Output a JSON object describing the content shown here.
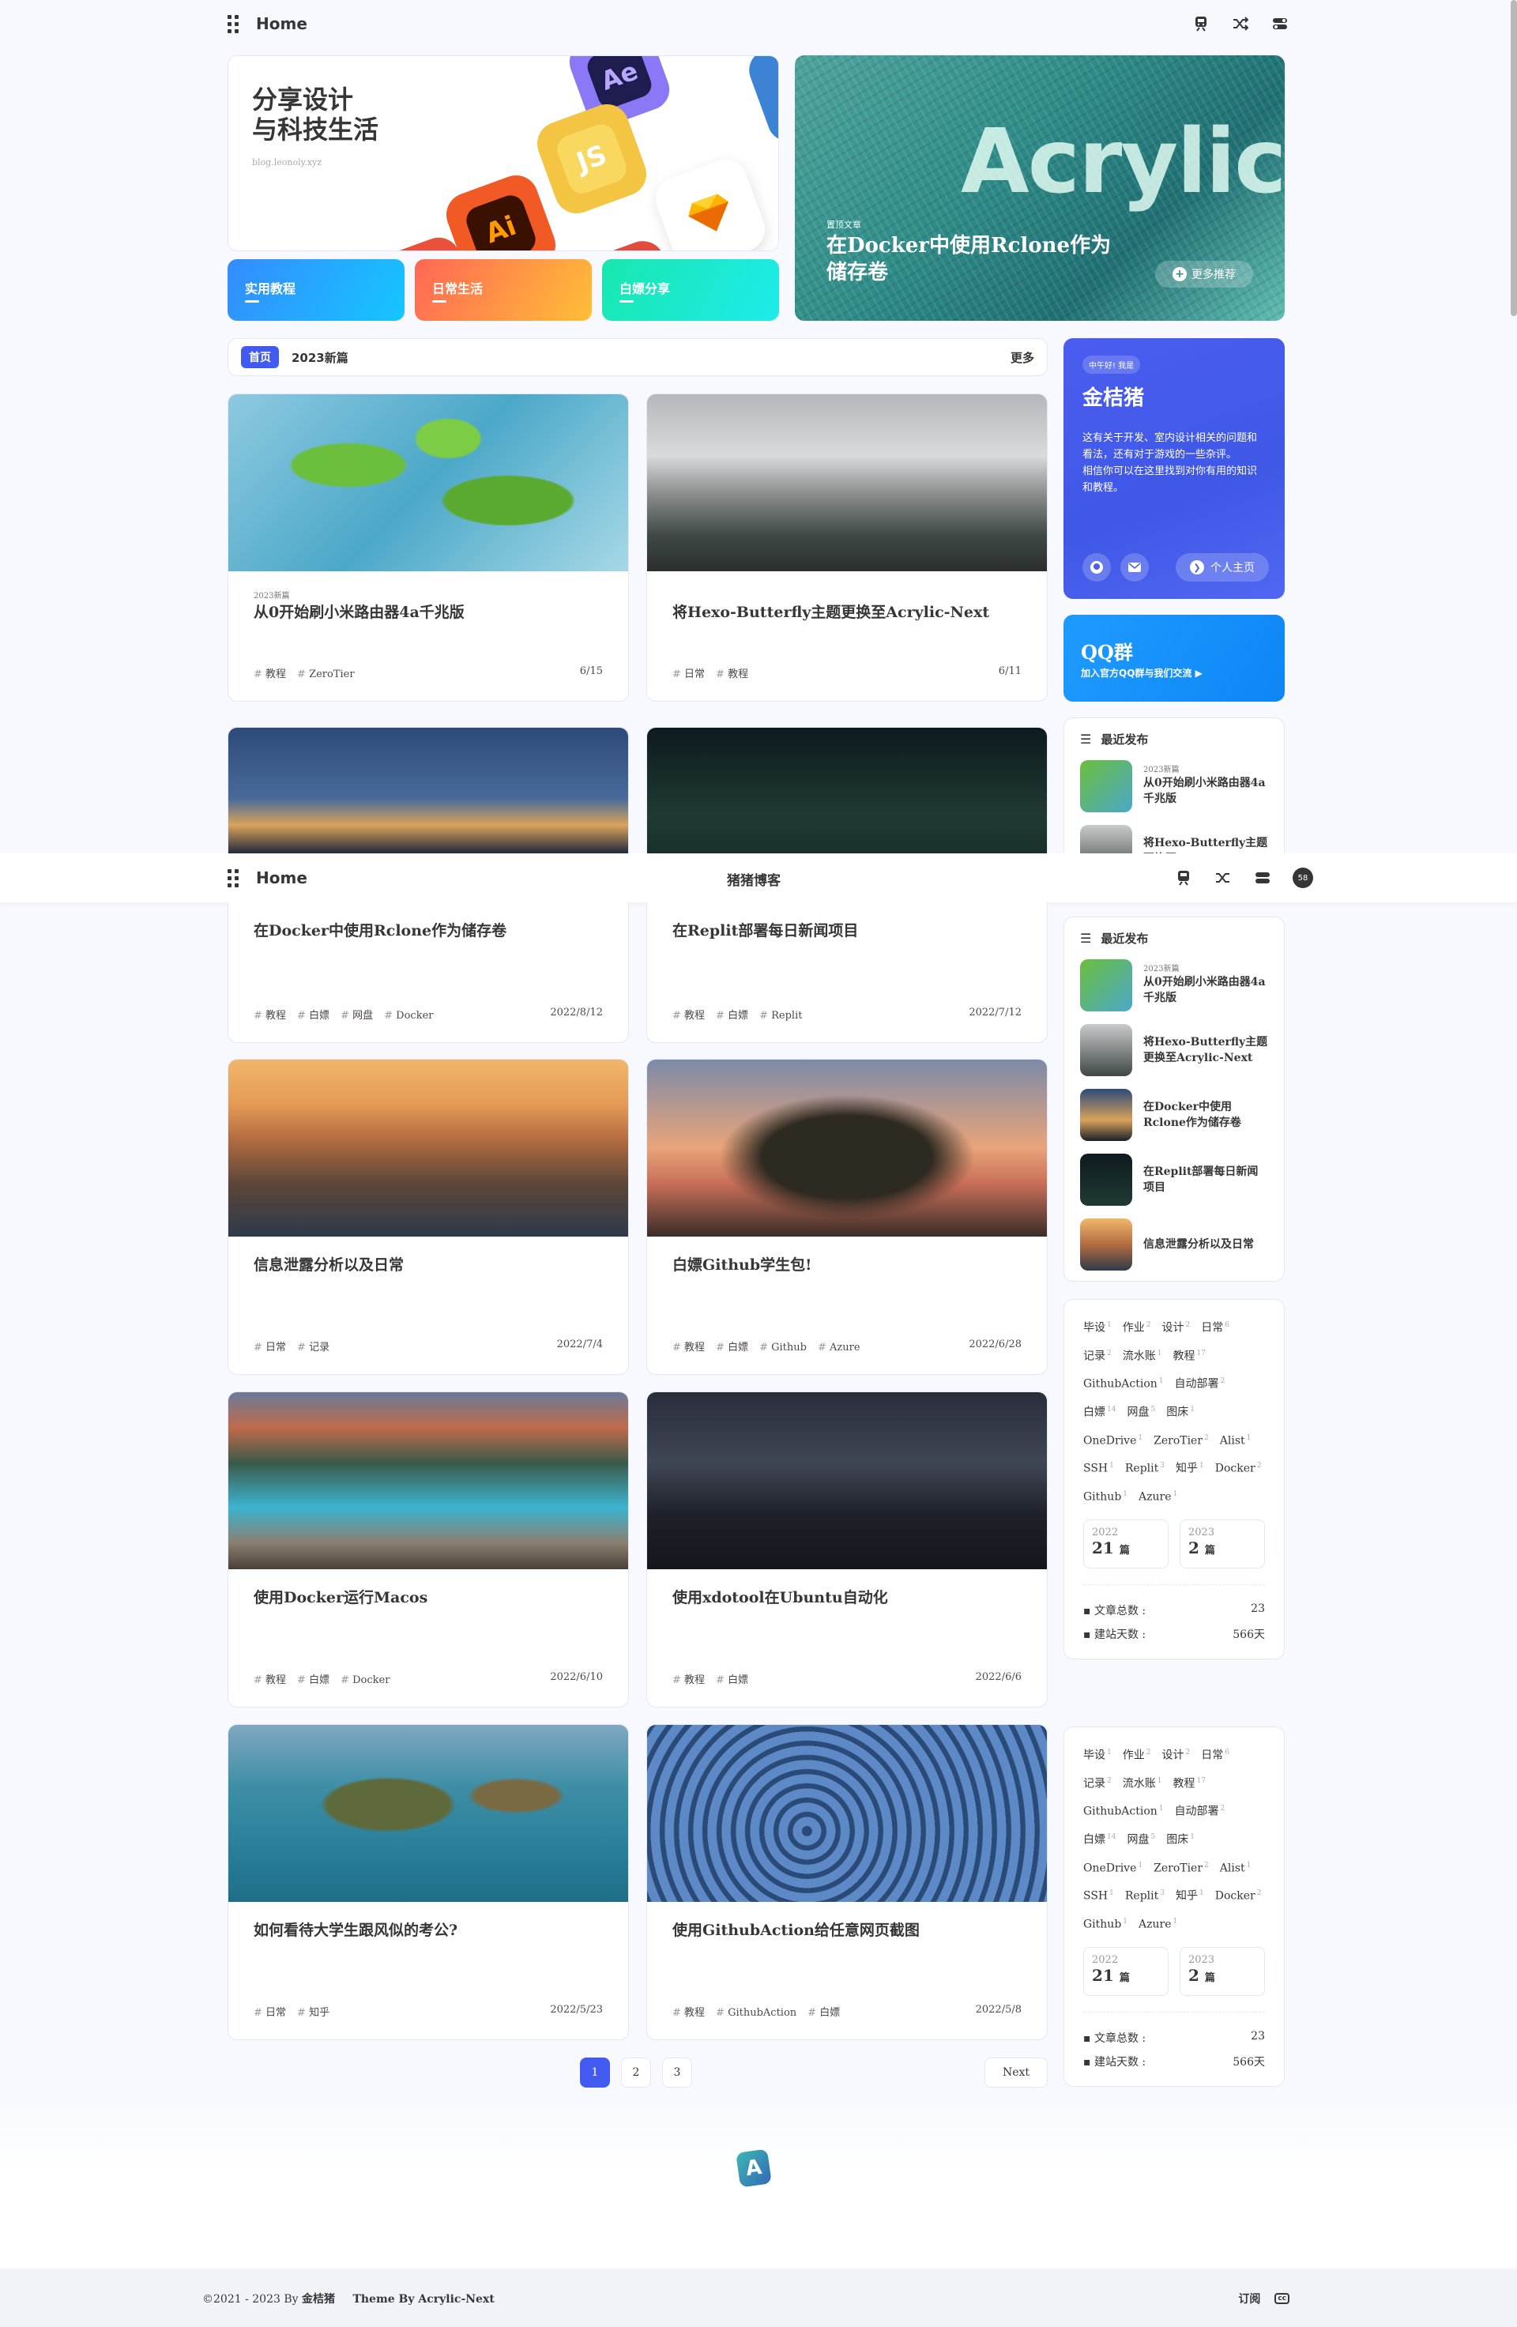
{
  "top_nav": {
    "brand": "Home"
  },
  "sticky_nav": {
    "brand": "Home",
    "center_title": "猪猪博客",
    "avatar": "58"
  },
  "hero": {
    "slogan_line1": "分享设计",
    "slogan_line2": "与科技生活",
    "site_url": "blog.leonoly.xyz",
    "icon_tiles": [
      "Ai",
      "JS",
      "Ae"
    ],
    "categories": [
      {
        "label": "实用教程",
        "color": "#358bff"
      },
      {
        "label": "日常生活",
        "color": "#f65"
      },
      {
        "label": "白嫖分享",
        "color": "#18e7ae"
      }
    ],
    "featured_tag": "置顶文章",
    "featured_title": "在Docker中使用Rclone作为储存卷",
    "featured_bg_text": "Acrylic",
    "more_label": "更多推荐"
  },
  "category_bar": {
    "home_label": "首页",
    "active": "2023新篇",
    "more": "更多"
  },
  "posts": [
    {
      "badge": "2023新篇",
      "title": "从0开始刷小米路由器4a千兆版",
      "tags": [
        "教程",
        "ZeroTier"
      ],
      "date": "6/15"
    },
    {
      "badge": "",
      "title": "将Hexo-Butterfly主题更换至Acrylic-Next",
      "tags": [
        "日常",
        "教程"
      ],
      "date": "6/11"
    },
    {
      "badge": "",
      "title": "在Docker中使用Rclone作为储存卷",
      "tags": [
        "教程",
        "白嫖",
        "网盘",
        "Docker"
      ],
      "date": "2022/8/12"
    },
    {
      "badge": "",
      "title": "在Replit部署每日新闻项目",
      "tags": [
        "教程",
        "白嫖",
        "Replit"
      ],
      "date": "2022/7/12"
    },
    {
      "badge": "",
      "title": "信息泄露分析以及日常",
      "tags": [
        "日常",
        "记录"
      ],
      "date": "2022/7/4"
    },
    {
      "badge": "",
      "title": "白嫖Github学生包!",
      "tags": [
        "教程",
        "白嫖",
        "Github",
        "Azure"
      ],
      "date": "2022/6/28"
    },
    {
      "badge": "",
      "title": "使用Docker运行Macos",
      "tags": [
        "教程",
        "白嫖",
        "Docker"
      ],
      "date": "2022/6/10"
    },
    {
      "badge": "",
      "title": "使用xdotool在Ubuntu自动化",
      "tags": [
        "教程",
        "白嫖"
      ],
      "date": "2022/6/6"
    },
    {
      "badge": "",
      "title": "如何看待大学生跟风似的考公?",
      "tags": [
        "日常",
        "知乎"
      ],
      "date": "2022/5/23"
    },
    {
      "badge": "",
      "title": "使用GithubAction给任意网页截图",
      "tags": [
        "教程",
        "GithubAction",
        "白嫖"
      ],
      "date": "2022/5/8"
    }
  ],
  "profile": {
    "greeting": "中午好! 我是",
    "name": "金桔猪",
    "desc1": "这有关于开发、室内设计相关的问题和看法，还有对于游戏的一些杂评。",
    "desc2": "相信你可以在这里找到对你有用的知识和教程。",
    "home_button": "个人主页"
  },
  "qq": {
    "title": "QQ群",
    "subtitle": "加入官方QQ群与我们交流 ▶"
  },
  "recent": {
    "title": "最近发布",
    "items": [
      {
        "badge": "2023新篇",
        "title": "从0开始刷小米路由器4a千兆版"
      },
      {
        "badge": "",
        "title": "将Hexo-Butterfly主题更换至Acrylic-Next"
      },
      {
        "badge": "",
        "title": "在Docker中使用Rclone作为储存卷"
      },
      {
        "badge": "",
        "title": "在Replit部署每日新闻项目"
      },
      {
        "badge": "",
        "title": "信息泄露分析以及日常"
      }
    ]
  },
  "tags": [
    {
      "n": "毕设",
      "c": "1"
    },
    {
      "n": "作业",
      "c": "2"
    },
    {
      "n": "设计",
      "c": "2"
    },
    {
      "n": "日常",
      "c": "6"
    },
    {
      "n": "记录",
      "c": "2"
    },
    {
      "n": "流水账",
      "c": "1"
    },
    {
      "n": "教程",
      "c": "17"
    },
    {
      "n": "GithubAction",
      "c": "1"
    },
    {
      "n": "自动部署",
      "c": "2"
    },
    {
      "n": "白嫖",
      "c": "14"
    },
    {
      "n": "网盘",
      "c": "5"
    },
    {
      "n": "图床",
      "c": "1"
    },
    {
      "n": "OneDrive",
      "c": "1"
    },
    {
      "n": "ZeroTier",
      "c": "2"
    },
    {
      "n": "Alist",
      "c": "1"
    },
    {
      "n": "SSH",
      "c": "1"
    },
    {
      "n": "Replit",
      "c": "3"
    },
    {
      "n": "知乎",
      "c": "1"
    },
    {
      "n": "Docker",
      "c": "2"
    },
    {
      "n": "Github",
      "c": "1"
    },
    {
      "n": "Azure",
      "c": "1"
    }
  ],
  "archives": [
    {
      "year": "2022",
      "count": "21",
      "unit": "篇"
    },
    {
      "year": "2023",
      "count": "2",
      "unit": "篇"
    }
  ],
  "stats": {
    "posts_label": "文章总数 :",
    "posts_value": "23",
    "days_label": "建站天数 :",
    "days_value": "566天"
  },
  "pagination": {
    "pages": [
      "1",
      "2",
      "3"
    ],
    "next": "Next"
  },
  "footer": {
    "copyright": "©2021 - 2023 By",
    "author": "金桔猪",
    "theme": "Theme By Acrylic-Next",
    "rss": "订阅",
    "cc": "cc"
  },
  "colors": {
    "accent": "#425aef",
    "bg": "#f7f9fe"
  }
}
